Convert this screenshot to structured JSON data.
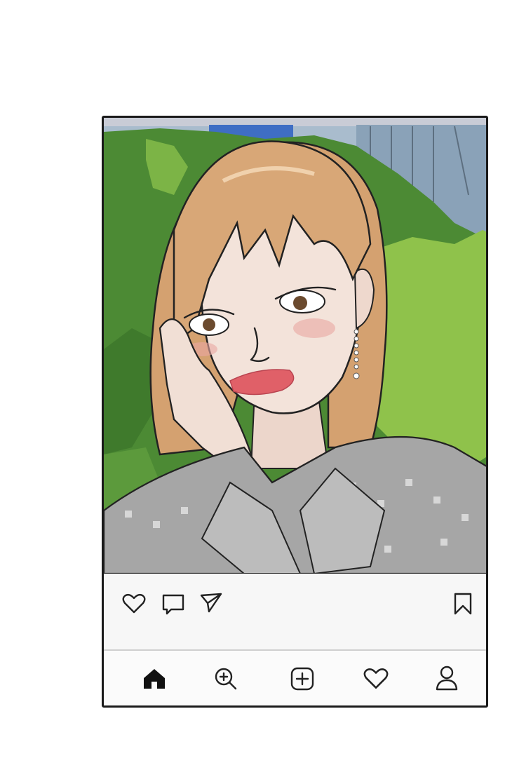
{
  "post": {
    "image_alt": "",
    "actions": {
      "like_icon": "heart-outline-icon",
      "comment_icon": "comment-icon",
      "share_icon": "paper-plane-icon",
      "save_icon": "bookmark-icon"
    }
  },
  "bottom_nav": {
    "items": [
      {
        "icon": "home-icon",
        "active": true
      },
      {
        "icon": "search-icon",
        "active": false
      },
      {
        "icon": "add-post-icon",
        "active": false
      },
      {
        "icon": "activity-heart-icon",
        "active": false
      },
      {
        "icon": "profile-icon",
        "active": false
      }
    ]
  },
  "colors": {
    "frame": "#1a1a1a",
    "sky": "#9fb3c8",
    "foliage_dark": "#4f8a35",
    "foliage_light": "#8cc04a",
    "hair": "#d9a97a",
    "skin": "#f3e3da",
    "lips": "#e0606a",
    "shirt": "#9a9a9a"
  }
}
